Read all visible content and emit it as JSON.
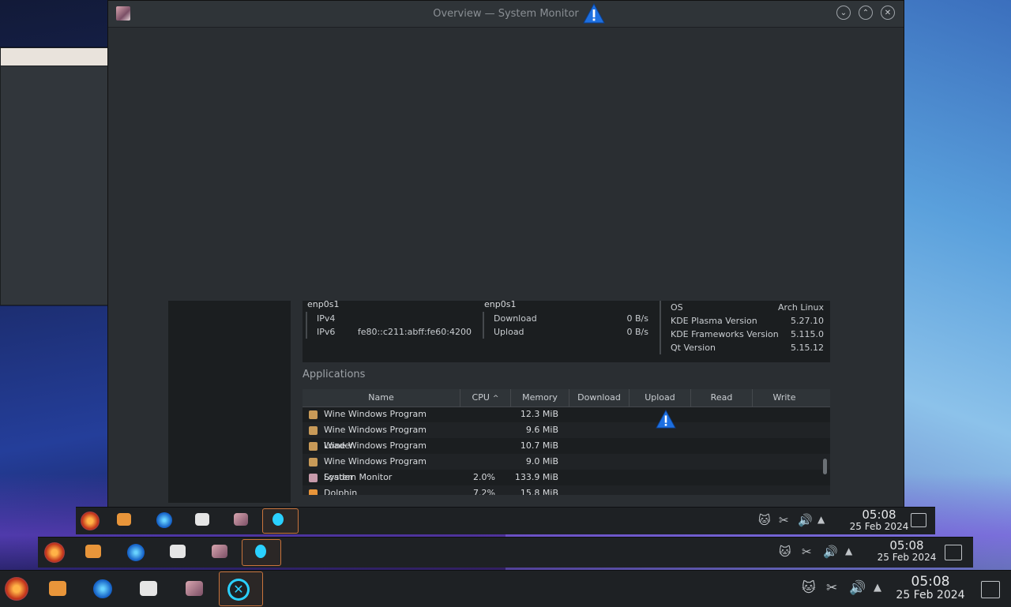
{
  "window": {
    "title": "Overview — System Monitor",
    "ghost_title": "Overview — System Monitor",
    "ghost_header": "Overview"
  },
  "network": {
    "col1": {
      "name": "enp0s1",
      "rows": [
        {
          "k": "IPv4",
          "v": ""
        },
        {
          "k": "IPv6",
          "v": "fe80::c211:abff:fe60:4200"
        }
      ]
    },
    "col2": {
      "name": "enp0s1",
      "rows": [
        {
          "k": "Download",
          "v": "0 B/s"
        },
        {
          "k": "Upload",
          "v": "0 B/s"
        }
      ]
    },
    "col3": {
      "rows": [
        {
          "k": "OS",
          "v": "Arch Linux"
        },
        {
          "k": "KDE Plasma Version",
          "v": "5.27.10"
        },
        {
          "k": "KDE Frameworks Version",
          "v": "5.115.0"
        },
        {
          "k": "Qt Version",
          "v": "5.15.12"
        }
      ]
    }
  },
  "applications": {
    "title": "Applications",
    "columns": [
      "Name",
      "CPU",
      "Memory",
      "Download",
      "Upload",
      "Read",
      "Write"
    ],
    "rows": [
      {
        "name": "Wine Windows Program Loader",
        "cpu": "",
        "memory": "12.3 MiB",
        "icon": "wine-icon"
      },
      {
        "name": "Wine Windows Program Loader",
        "cpu": "",
        "memory": "9.6 MiB",
        "icon": "wine-icon"
      },
      {
        "name": "Wine Windows Program Loader",
        "cpu": "",
        "memory": "10.7 MiB",
        "icon": "wine-icon"
      },
      {
        "name": "Wine Windows Program Loader",
        "cpu": "",
        "memory": "9.0 MiB",
        "icon": "wine-icon"
      },
      {
        "name": "System Monitor",
        "cpu": "2.0%",
        "memory": "133.9 MiB",
        "icon": "system-monitor-icon"
      },
      {
        "name": "Dolphin",
        "cpu": "7.2%",
        "memory": "15.8 MiB",
        "icon": "folder-icon"
      }
    ]
  },
  "taskbar": {
    "clock_time": "05:08",
    "clock_date": "25 Feb 2024",
    "apps": [
      "firefox-icon",
      "dolphin-icon",
      "firefox-dev-icon",
      "archive-icon",
      "system-monitor-icon",
      "wine-icon"
    ]
  },
  "colors": {
    "accent": "#c9743c",
    "warning": "#1d6fe0"
  }
}
